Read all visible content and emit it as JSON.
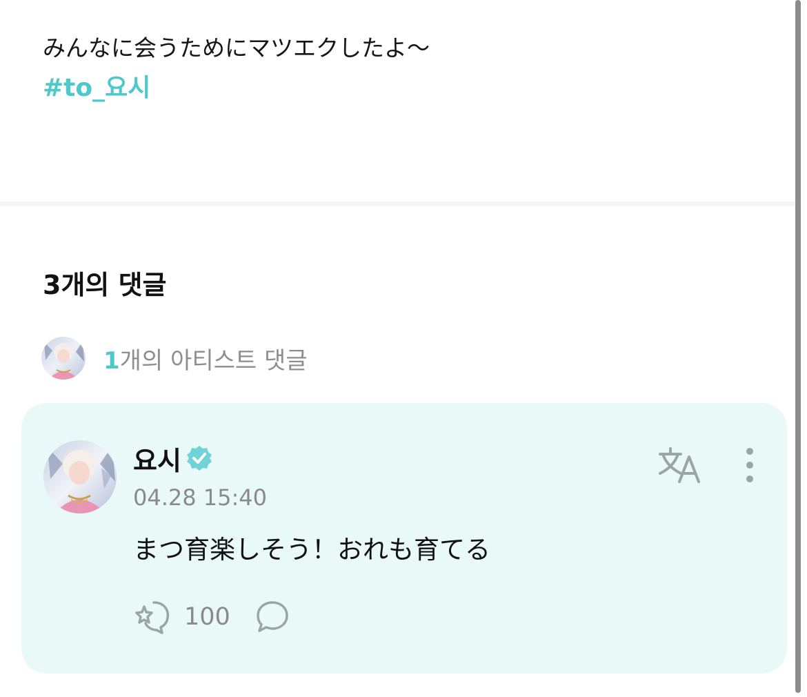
{
  "post": {
    "text": "みんなに会うためにマツエクしたよ〜",
    "hashtag": "#to_요시"
  },
  "comments": {
    "heading": "3개의 댓글",
    "artist_summary": {
      "count": "1",
      "suffix": "개의 아티스트 댓글"
    },
    "items": [
      {
        "author": "요시",
        "verified": true,
        "timestamp": "04.28 15:40",
        "text": "まつ育楽しそう！おれも育てる",
        "like_count": "100"
      }
    ]
  },
  "colors": {
    "accent": "#4fc8cc",
    "card_background": "#e9f9f7",
    "secondary_text": "#8a8a8a",
    "icon_gray": "#9aa5a6"
  },
  "icons": {
    "verified": "verified-badge-icon",
    "translate": "translate-icon",
    "more": "more-vertical-icon",
    "like": "like-icon",
    "reply": "comment-bubble-icon",
    "avatar": "avatar-image"
  }
}
